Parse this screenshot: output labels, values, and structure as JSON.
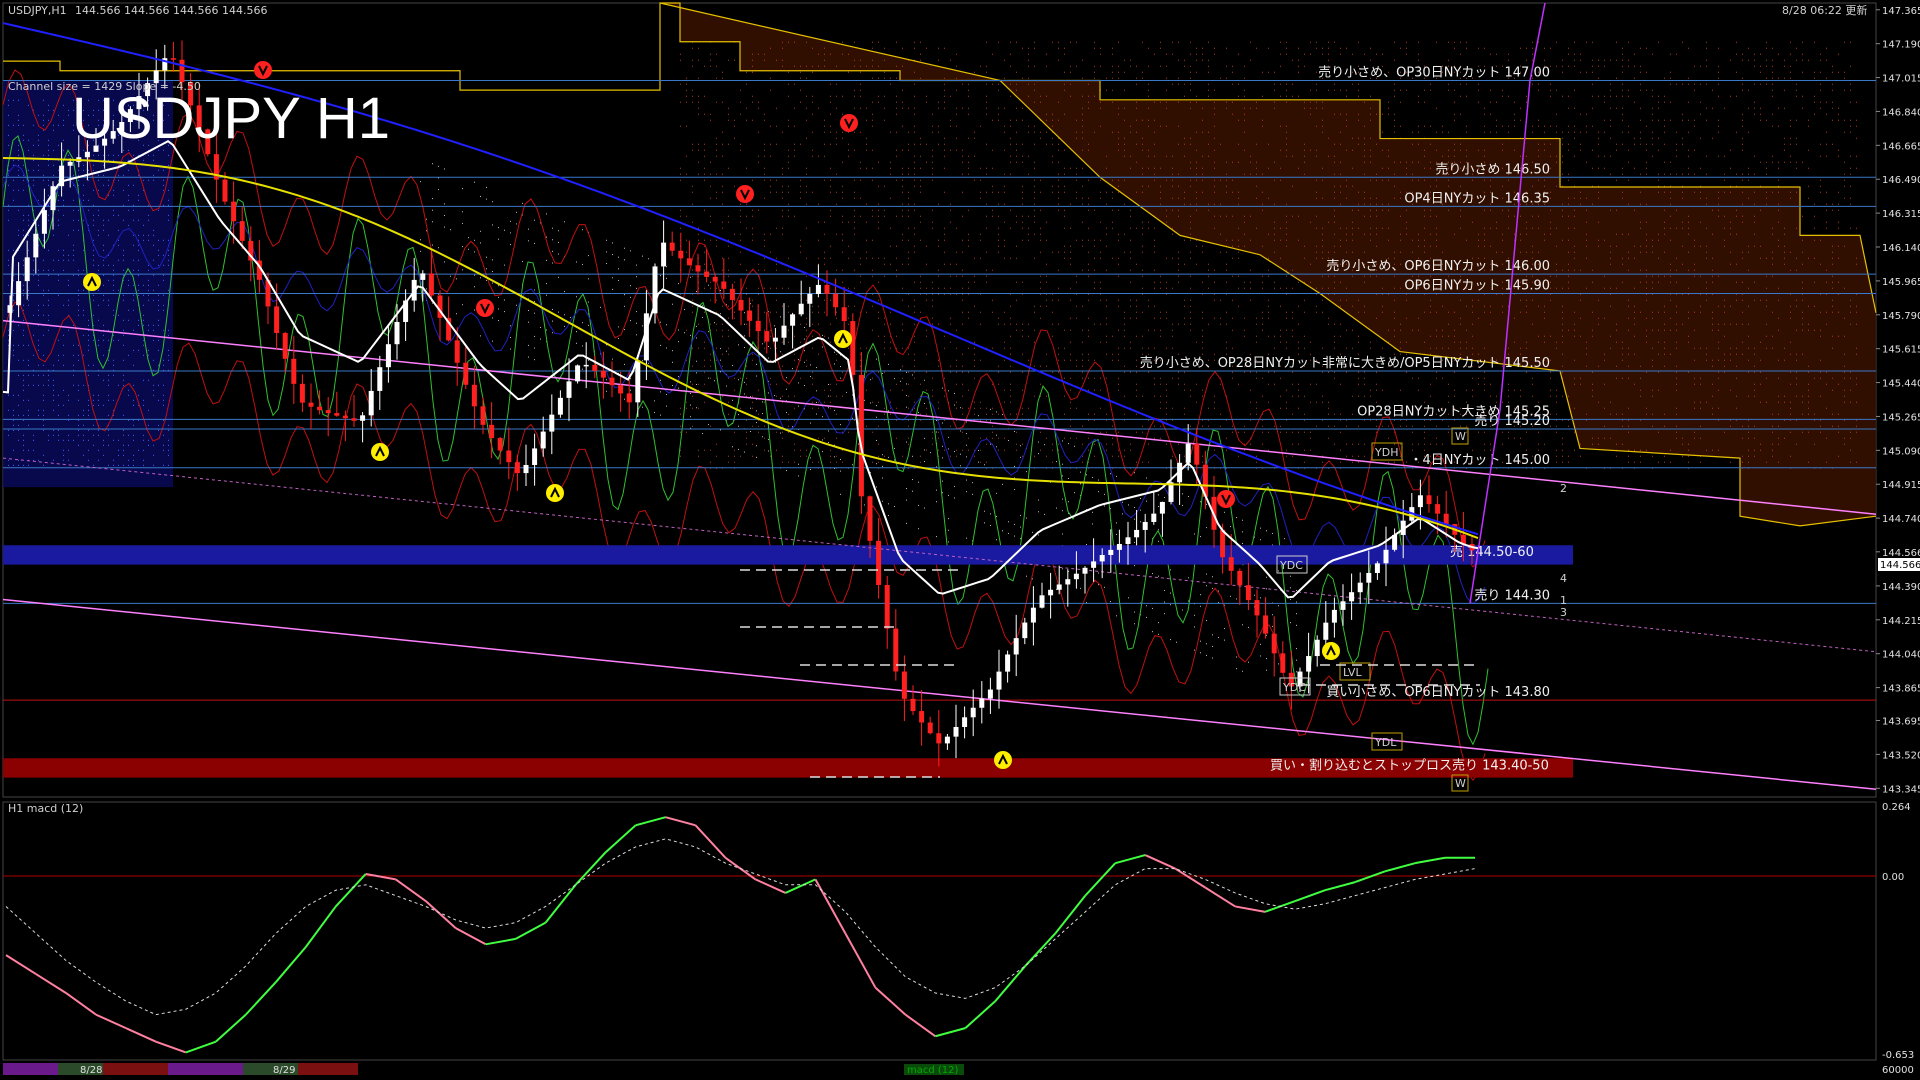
{
  "header": {
    "symbol_info": "USDJPY,H1",
    "ohlc": "144.566 144.566 144.566 144.566",
    "timestamp": "8/28 06:22 更新",
    "channel_info": "Channel size = 1429 Slope = -4.50"
  },
  "title": "USDJPY H1",
  "current_price": "144.566",
  "price_axis_ticks": [
    "147.365",
    "147.190",
    "147.015",
    "146.840",
    "146.665",
    "146.490",
    "146.315",
    "146.140",
    "145.965",
    "145.790",
    "145.615",
    "145.440",
    "145.265",
    "145.090",
    "144.915",
    "144.740",
    "144.566",
    "144.390",
    "144.215",
    "144.040",
    "143.865",
    "143.695",
    "143.520",
    "143.345"
  ],
  "levels": [
    {
      "price": 147.0,
      "label": "売り小さめ、OP30日NYカット 147.00"
    },
    {
      "price": 146.5,
      "label": "売り小さめ 146.50"
    },
    {
      "price": 146.35,
      "label": "OP4日NYカット 146.35"
    },
    {
      "price": 146.0,
      "label": "売り小さめ、OP6日NYカット 146.00"
    },
    {
      "price": 145.9,
      "label": "OP6日NYカット 145.90"
    },
    {
      "price": 145.5,
      "label": "売り小さめ、OP28日NYカット非常に大きめ/OP5日NYカット 145.50"
    },
    {
      "price": 145.25,
      "label": "OP28日NYカット大きめ 145.25"
    },
    {
      "price": 145.2,
      "label": "売り 145.20"
    },
    {
      "price": 145.0,
      "label": "・4日NYカット 145.00"
    },
    {
      "price": 144.3,
      "label": "売り 144.30"
    },
    {
      "price": 143.8,
      "label": "買い小さめ、OP6日NYカット 143.80"
    }
  ],
  "zones": [
    {
      "low": 144.5,
      "high": 144.6,
      "label": "売 144.50-60"
    },
    {
      "low": 143.4,
      "high": 143.5,
      "label": "買い・割り込むとストップロス売り 143.40-50"
    }
  ],
  "markers": {
    "ydc": "YDC",
    "ydh": "YDH",
    "ydl": "YDL",
    "lvl": "LVL",
    "w": "W",
    "num_2": "2",
    "num_4": "4",
    "num_1": "1",
    "num_3": "3"
  },
  "macd_panel": {
    "label": "H1  macd (12)",
    "top_value": "0.264",
    "zero_value": "0.00",
    "bottom_value": "-0.653",
    "corner_value": "60000",
    "footer_label": "macd (12)",
    "date_labels": [
      "8/28",
      "8/29"
    ]
  },
  "colors": {
    "background": "#000000",
    "blue_band": "#1a1aa0",
    "red_band": "#8b0000",
    "level_line": "#3a78c8",
    "up_candle": "#ffffff",
    "down_candle": "#ff2020",
    "ma_white": "#ffffff",
    "ma_yellow": "#e6e000",
    "ma_blue": "#2020ff",
    "channel": "#ff80ff",
    "macd_up": "#40ff40",
    "macd_down": "#ff80a0",
    "kumo_upper": "#e6c000"
  },
  "chart_data": {
    "type": "candlestick",
    "ylim": [
      143.3,
      147.4
    ],
    "series_count_candles": 170,
    "channel_upper": [
      145.76,
      144.76
    ],
    "channel_lower": [
      144.32,
      143.34
    ],
    "macd_ylim": [
      -0.653,
      0.264
    ],
    "macd_line": [
      -0.28,
      -0.35,
      -0.42,
      -0.5,
      -0.55,
      -0.6,
      -0.64,
      -0.6,
      -0.5,
      -0.38,
      -0.25,
      -0.1,
      0.02,
      0.0,
      -0.08,
      -0.18,
      -0.24,
      -0.22,
      -0.16,
      -0.02,
      0.1,
      0.2,
      0.23,
      0.2,
      0.08,
      0.0,
      -0.05,
      0.0,
      -0.2,
      -0.4,
      -0.5,
      -0.58,
      -0.55,
      -0.45,
      -0.32,
      -0.2,
      -0.06,
      0.06,
      0.09,
      0.04,
      -0.03,
      -0.1,
      -0.12,
      -0.08,
      -0.04,
      -0.01,
      0.03,
      0.06,
      0.08,
      0.08
    ],
    "signal_line": [
      -0.1,
      -0.2,
      -0.3,
      -0.38,
      -0.45,
      -0.5,
      -0.48,
      -0.42,
      -0.32,
      -0.2,
      -0.1,
      -0.04,
      -0.02,
      -0.06,
      -0.1,
      -0.15,
      -0.18,
      -0.16,
      -0.1,
      -0.02,
      0.06,
      0.12,
      0.15,
      0.12,
      0.06,
      0.02,
      -0.02,
      -0.02,
      -0.12,
      -0.25,
      -0.36,
      -0.42,
      -0.44,
      -0.4,
      -0.32,
      -0.22,
      -0.12,
      -0.02,
      0.04,
      0.04,
      0.0,
      -0.05,
      -0.09,
      -0.11,
      -0.09,
      -0.06,
      -0.03,
      0.0,
      0.02,
      0.04
    ]
  }
}
